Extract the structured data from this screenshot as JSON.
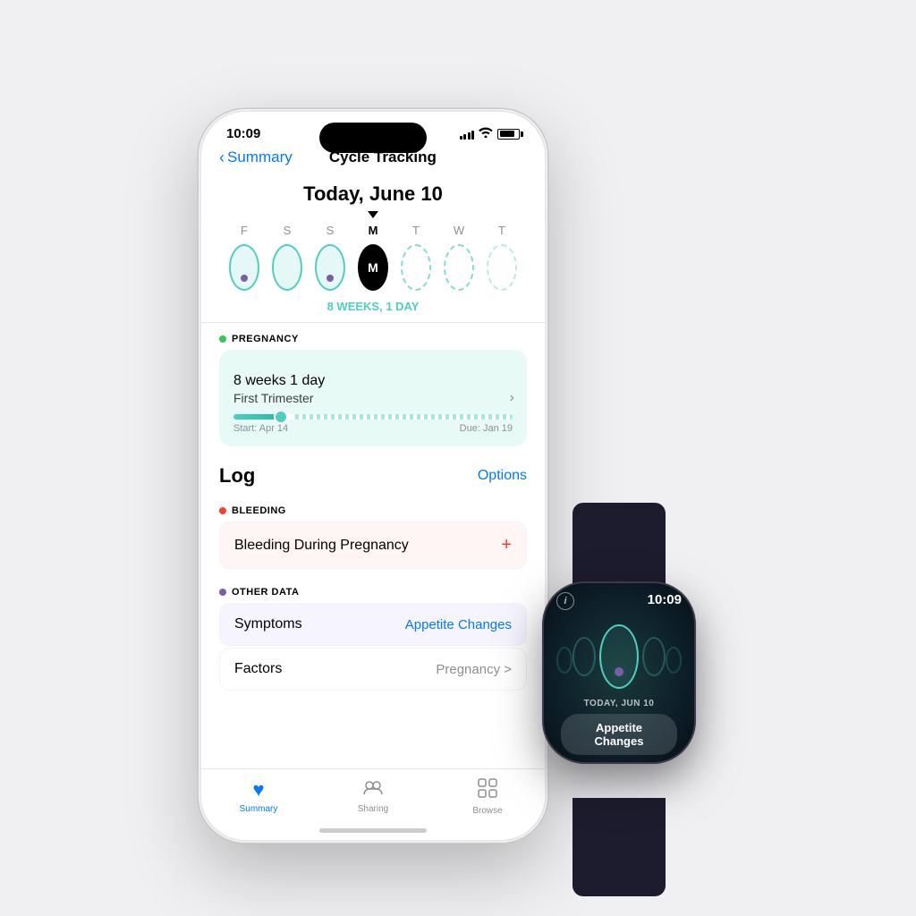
{
  "background_color": "#f0f0f2",
  "iphone": {
    "status_bar": {
      "time": "10:09",
      "signal": "●●●●",
      "wifi": "wifi",
      "battery": "battery"
    },
    "nav": {
      "back_label": "Summary",
      "title": "Cycle Tracking"
    },
    "date_header": "Today, June 10",
    "calendar": {
      "days": [
        "F",
        "S",
        "S",
        "M",
        "T",
        "W",
        "T"
      ],
      "today_index": 3,
      "today_letter": "M",
      "weeks_label": "8 WEEKS, 1 DAY"
    },
    "pregnancy_section": {
      "label": "PREGNANCY",
      "weeks_number": "8",
      "weeks_unit": " weeks ",
      "days_number": "1",
      "days_unit": " day",
      "trimester": "First Trimester",
      "start_label": "Start: Apr 14",
      "due_label": "Due: Jan 19"
    },
    "log": {
      "title": "Log",
      "options_label": "Options",
      "bleeding_section_label": "BLEEDING",
      "bleeding_item": "Bleeding During Pregnancy",
      "other_data_label": "OTHER DATA",
      "symptoms_label": "Symptoms",
      "symptoms_value": "Appetite Changes",
      "factors_label": "Factors",
      "factors_value": "Pregnancy >"
    },
    "tab_bar": {
      "tabs": [
        {
          "label": "Summary",
          "active": true,
          "icon": "♥"
        },
        {
          "label": "Sharing",
          "active": false,
          "icon": "👥"
        },
        {
          "label": "Browse",
          "active": false,
          "icon": "⊞"
        }
      ]
    }
  },
  "watch": {
    "time": "10:09",
    "date": "TODAY, JUN 10",
    "pill_text": "Appetite Changes"
  }
}
